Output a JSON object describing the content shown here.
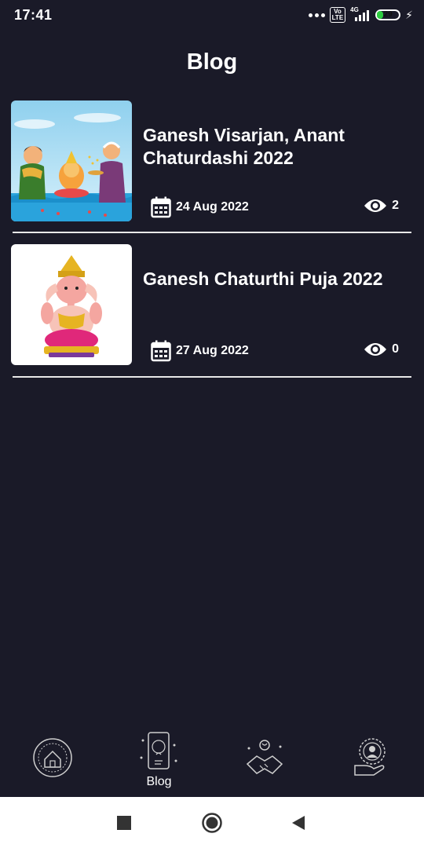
{
  "status_bar": {
    "time": "17:41",
    "volte_label": "Vo\nLTE",
    "network_label": "4G",
    "battery_level": "29",
    "battery_fill_fraction": 0.29
  },
  "page_title": "Blog",
  "posts": [
    {
      "title": "Ganesh Visarjan, Anant Chaturdashi 2022",
      "date": "24 Aug 2022",
      "views": "2",
      "thumbnail": "ganesh-visarjan-illustration"
    },
    {
      "title": "Ganesh Chaturthi Puja 2022",
      "date": "27 Aug 2022",
      "views": "0",
      "thumbnail": "ganesh-idol-photo"
    }
  ],
  "bottom_nav": {
    "items": [
      {
        "icon": "astro-house-icon",
        "label": ""
      },
      {
        "icon": "blog-phone-icon",
        "label": "Blog",
        "active": true
      },
      {
        "icon": "handshake-icon",
        "label": ""
      },
      {
        "icon": "consultant-hand-icon",
        "label": ""
      }
    ]
  },
  "system_nav": {
    "icons": [
      "recents-square-icon",
      "home-circle-icon",
      "back-triangle-icon"
    ]
  },
  "colors": {
    "background": "#1a1a28",
    "text": "#ffffff",
    "battery": "#2ecc40",
    "system_nav_bg": "#ffffff",
    "system_nav_icon": "#333333"
  }
}
